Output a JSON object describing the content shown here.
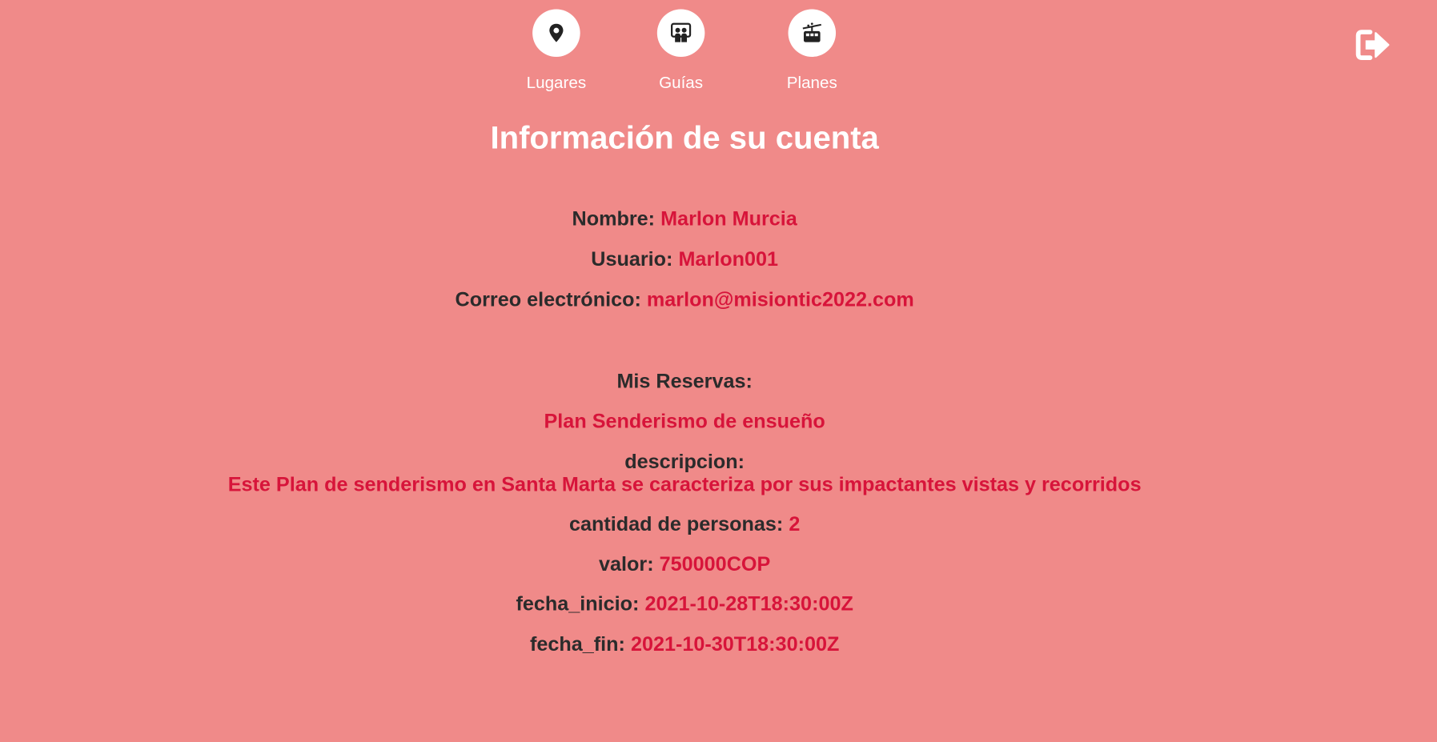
{
  "nav": {
    "items": [
      {
        "label": "Lugares",
        "icon": "map-pin-icon"
      },
      {
        "label": "Guías",
        "icon": "guides-icon"
      },
      {
        "label": "Planes",
        "icon": "cable-car-icon"
      }
    ],
    "logout_icon": "logout-icon"
  },
  "page_title": "Información de su cuenta",
  "account": {
    "name_label": "Nombre:",
    "name_value": "Marlon Murcia",
    "user_label": "Usuario:",
    "user_value": "Marlon001",
    "email_label": "Correo electrónico:",
    "email_value": "marlon@misiontic2022.com"
  },
  "reservations": {
    "heading": "Mis Reservas:",
    "plan_name": "Plan Senderismo de ensueño",
    "description_label": "descripcion:",
    "description_value": "Este Plan de senderismo en Santa Marta se caracteriza por sus impactantes vistas y recorridos",
    "people_label": "cantidad de personas:",
    "people_value": "2",
    "price_label": "valor:",
    "price_value": "750000COP",
    "start_label": "fecha_inicio:",
    "start_value": "2021-10-28T18:30:00Z",
    "end_label": "fecha_fin:",
    "end_value": "2021-10-30T18:30:00Z"
  },
  "colors": {
    "background": "#f08a89",
    "value_text": "#d7143a",
    "label_text": "#2b2b2b",
    "title_text": "#ffffff"
  }
}
